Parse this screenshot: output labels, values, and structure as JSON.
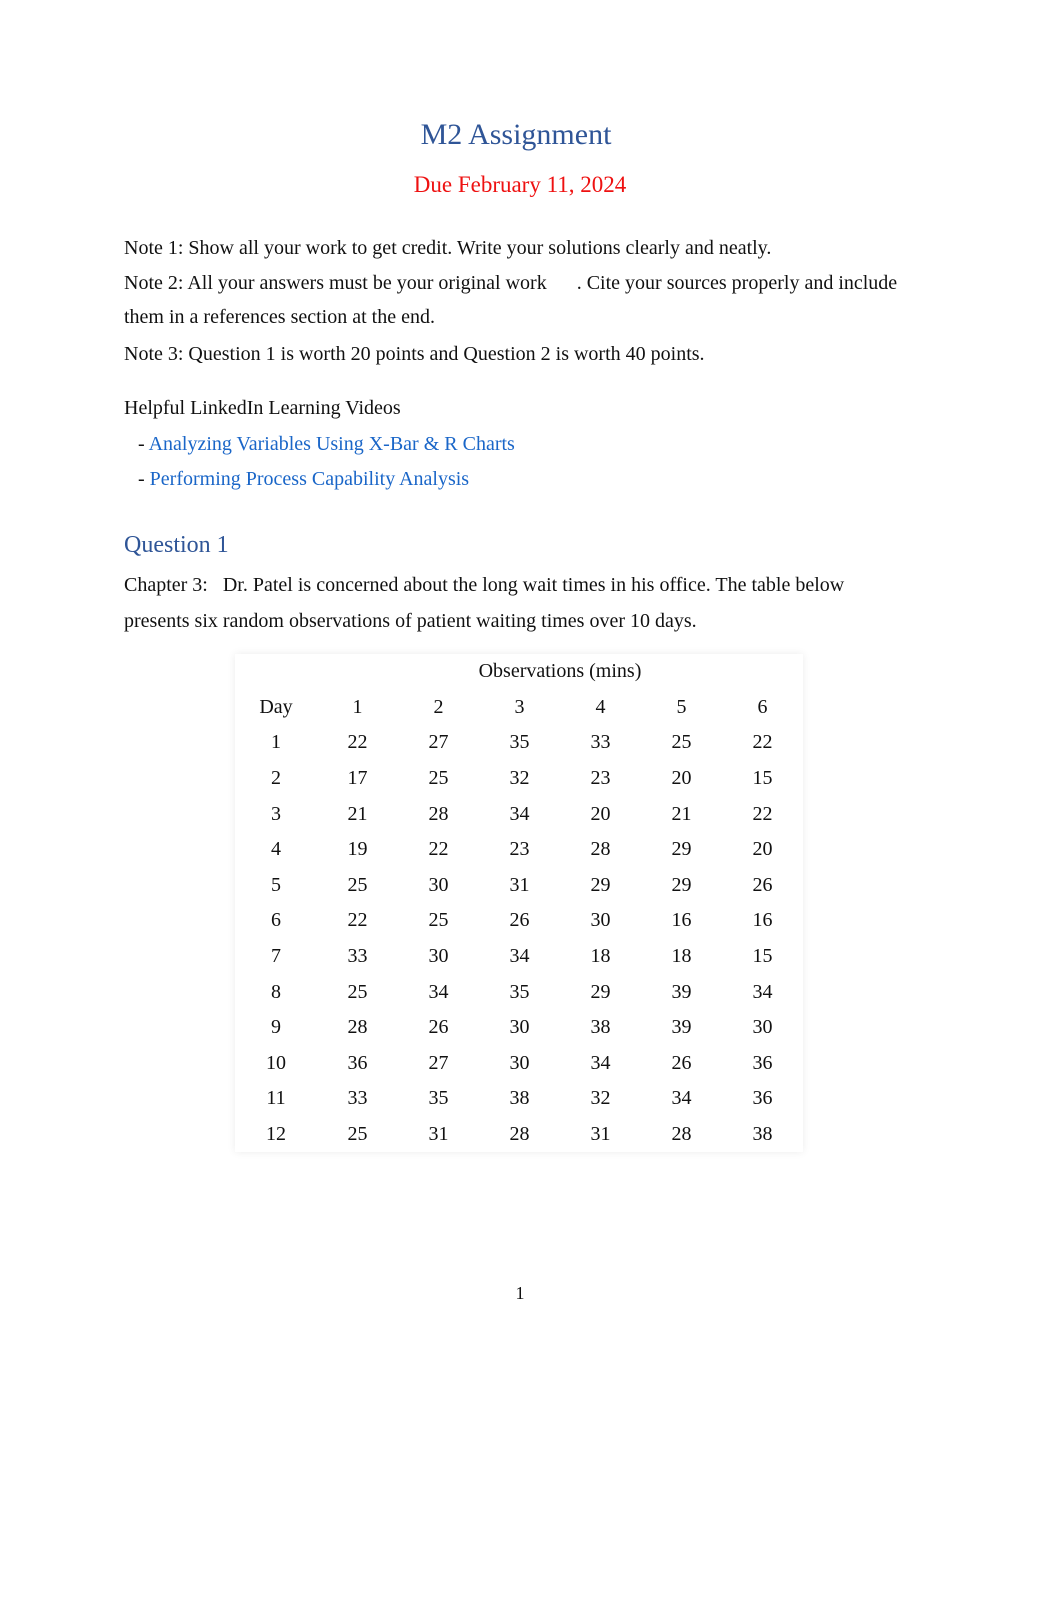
{
  "title": "M2 Assignment",
  "due": "Due February 11, 2024",
  "notes": [
    "Note 1: Show all your work to get credit. Write your solutions clearly and neatly.",
    "Note 2: All your answers must be your original work      . Cite your sources properly and include",
    "them in a references section at the end.",
    "Note 3: Question 1 is worth 20 points and Question 2 is worth 40 points."
  ],
  "videos": {
    "heading": "Helpful LinkedIn Learning Videos",
    "bullet": "-",
    "links": [
      "Analyzing Variables Using X-Bar & R Charts",
      "Performing Process Capability Analysis"
    ]
  },
  "question1": {
    "heading": "Question 1",
    "lines": [
      "Chapter 3:   Dr. Patel is concerned about the long wait times in his office. The table below",
      "presents six random observations of patient waiting times over 10 days."
    ]
  },
  "table": {
    "group_header": "Observations (mins)",
    "headers": [
      "Day",
      "1",
      "2",
      "3",
      "4",
      "5",
      "6"
    ],
    "rows": [
      [
        "1",
        "22",
        "27",
        "35",
        "33",
        "25",
        "22"
      ],
      [
        "2",
        "17",
        "25",
        "32",
        "23",
        "20",
        "15"
      ],
      [
        "3",
        "21",
        "28",
        "34",
        "20",
        "21",
        "22"
      ],
      [
        "4",
        "19",
        "22",
        "23",
        "28",
        "29",
        "20"
      ],
      [
        "5",
        "25",
        "30",
        "31",
        "29",
        "29",
        "26"
      ],
      [
        "6",
        "22",
        "25",
        "26",
        "30",
        "16",
        "16"
      ],
      [
        "7",
        "33",
        "30",
        "34",
        "18",
        "18",
        "15"
      ],
      [
        "8",
        "25",
        "34",
        "35",
        "29",
        "39",
        "34"
      ],
      [
        "9",
        "28",
        "26",
        "30",
        "38",
        "39",
        "30"
      ],
      [
        "10",
        "36",
        "27",
        "30",
        "34",
        "26",
        "36"
      ],
      [
        "11",
        "33",
        "35",
        "38",
        "32",
        "34",
        "36"
      ],
      [
        "12",
        "25",
        "31",
        "28",
        "31",
        "28",
        "38"
      ]
    ]
  },
  "page_number": "1",
  "colors": {
    "heading": "#2f5597",
    "due": "#ee1111",
    "link": "#1a66c8"
  }
}
